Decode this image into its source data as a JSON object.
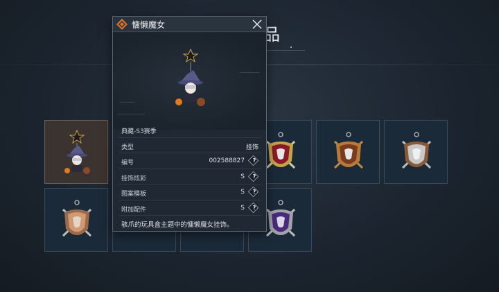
{
  "background": {
    "title_partial": "品"
  },
  "popup": {
    "title": "慵懒魔女",
    "logo_icon": "orange-diamond-emblem-icon",
    "close_icon": "close-icon",
    "rows": [
      {
        "label": "典藏-S3赛季",
        "value": "",
        "has_help": false
      },
      {
        "label": "类型",
        "value": "挂饰",
        "has_help": false
      },
      {
        "label": "编号",
        "value": "002588827",
        "has_help": true
      },
      {
        "label": "挂饰炫彩",
        "value": "S",
        "has_help": true
      },
      {
        "label": "图案模板",
        "value": "S",
        "has_help": true
      },
      {
        "label": "附加配件",
        "value": "S",
        "has_help": true
      }
    ],
    "help_glyph": "?",
    "description": "骇爪的玩具盒主题中的慵懒魔女挂饰。"
  },
  "items": [
    {
      "name": "witch-charm",
      "style": "witch",
      "selected": true
    },
    {
      "name": "shield-charm-red",
      "style": "shield",
      "colors": [
        "#c4a44a",
        "#8a1a2a"
      ]
    },
    {
      "name": "shield-charm-orange",
      "style": "shield",
      "colors": [
        "#b87a3a",
        "#7a3a1e"
      ]
    },
    {
      "name": "shield-charm-silver",
      "style": "shield",
      "colors": [
        "#c8c8c8",
        "#8a5a36"
      ]
    },
    {
      "name": "shield-charm-tan",
      "style": "shield",
      "colors": [
        "#d09a74",
        "#9a6a4a"
      ]
    },
    {
      "name": "shield-charm-purple",
      "style": "shield",
      "colors": [
        "#a0a4aa",
        "#4a2a7a"
      ]
    }
  ]
}
